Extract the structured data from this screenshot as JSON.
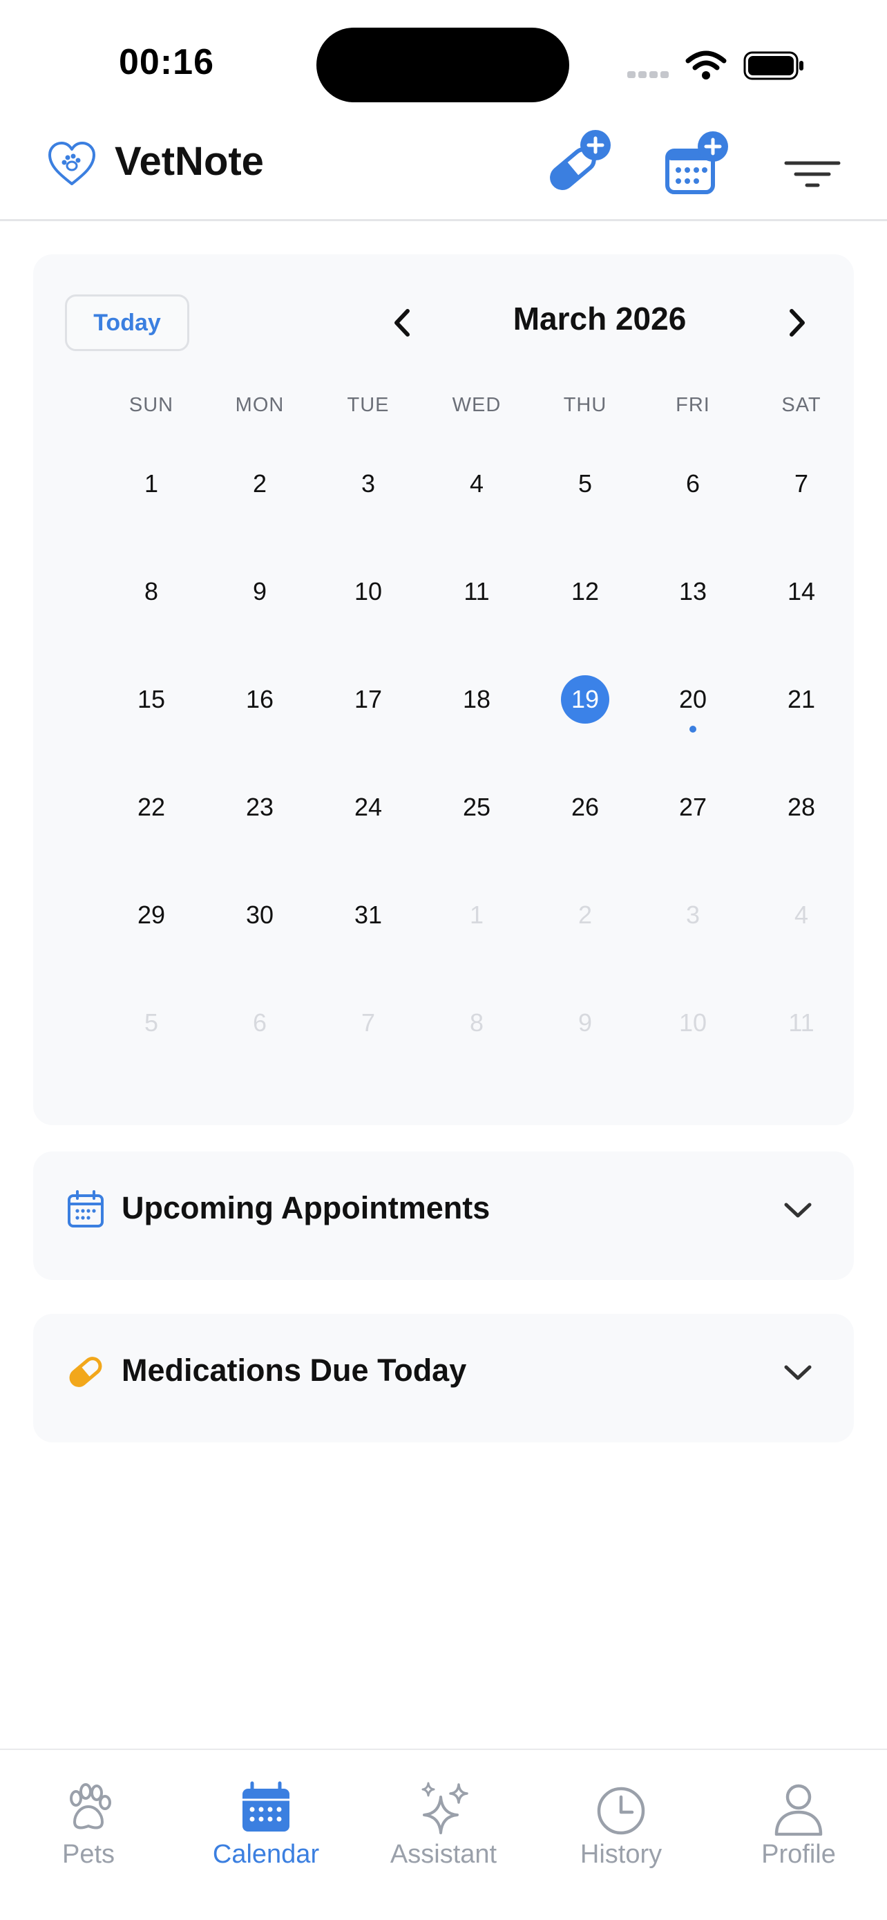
{
  "status_bar": {
    "time": "00:16"
  },
  "header": {
    "title": "VetNote"
  },
  "calendar": {
    "today_label": "Today",
    "month_title": "March 2026",
    "weekdays": [
      "SUN",
      "MON",
      "TUE",
      "WED",
      "THU",
      "FRI",
      "SAT"
    ],
    "days": [
      {
        "label": "1"
      },
      {
        "label": "2"
      },
      {
        "label": "3"
      },
      {
        "label": "4"
      },
      {
        "label": "5"
      },
      {
        "label": "6"
      },
      {
        "label": "7"
      },
      {
        "label": "8"
      },
      {
        "label": "9"
      },
      {
        "label": "10"
      },
      {
        "label": "11"
      },
      {
        "label": "12"
      },
      {
        "label": "13"
      },
      {
        "label": "14"
      },
      {
        "label": "15"
      },
      {
        "label": "16"
      },
      {
        "label": "17"
      },
      {
        "label": "18"
      },
      {
        "label": "19",
        "selected": true
      },
      {
        "label": "20",
        "has_event": true
      },
      {
        "label": "21"
      },
      {
        "label": "22"
      },
      {
        "label": "23"
      },
      {
        "label": "24"
      },
      {
        "label": "25"
      },
      {
        "label": "26"
      },
      {
        "label": "27"
      },
      {
        "label": "28"
      },
      {
        "label": "29"
      },
      {
        "label": "30"
      },
      {
        "label": "31"
      },
      {
        "label": "1",
        "muted": true
      },
      {
        "label": "2",
        "muted": true
      },
      {
        "label": "3",
        "muted": true
      },
      {
        "label": "4",
        "muted": true
      },
      {
        "label": "5",
        "muted": true
      },
      {
        "label": "6",
        "muted": true
      },
      {
        "label": "7",
        "muted": true
      },
      {
        "label": "8",
        "muted": true
      },
      {
        "label": "9",
        "muted": true
      },
      {
        "label": "10",
        "muted": true
      },
      {
        "label": "11",
        "muted": true
      }
    ]
  },
  "sections": {
    "appointments": {
      "title": "Upcoming Appointments",
      "icon": "calendar-icon"
    },
    "medications": {
      "title": "Medications Due Today",
      "icon": "pill-icon"
    }
  },
  "tabs": [
    {
      "label": "Pets",
      "icon": "paw-icon",
      "active": false
    },
    {
      "label": "Calendar",
      "icon": "calendar-icon",
      "active": true
    },
    {
      "label": "Assistant",
      "icon": "sparkles-icon",
      "active": false
    },
    {
      "label": "History",
      "icon": "clock-icon",
      "active": false
    },
    {
      "label": "Profile",
      "icon": "person-icon",
      "active": false
    }
  ],
  "colors": {
    "accent": "#3B7FE0",
    "pill": "#F2A71B",
    "muted_text": "#D7D9DE"
  }
}
